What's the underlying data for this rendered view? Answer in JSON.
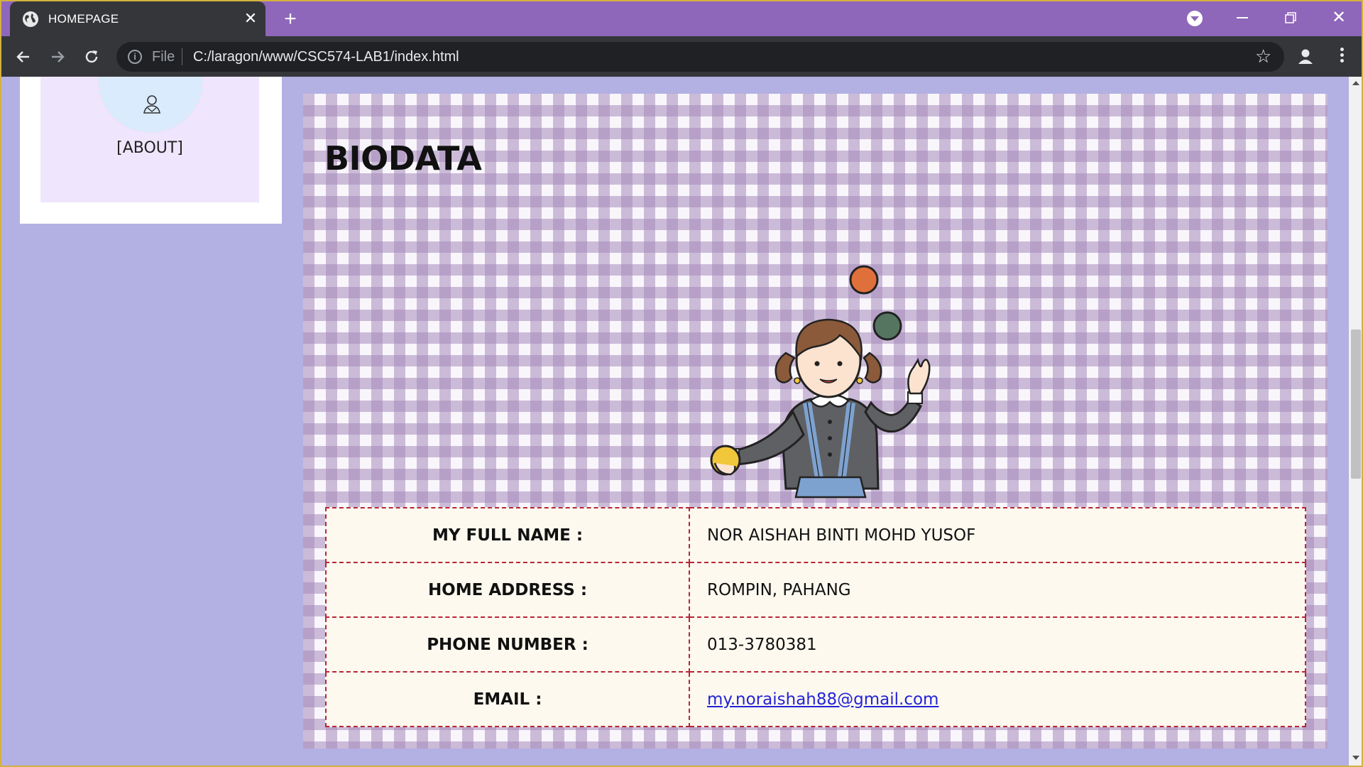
{
  "browser": {
    "tab_title": "HOMEPAGE",
    "tab_close_glyph": "✕",
    "new_tab_glyph": "+",
    "file_label": "File",
    "url": "C:/laragon/www/CSC574-LAB1/index.html",
    "icons": [
      "globe-icon",
      "back-icon",
      "forward-icon",
      "reload-icon",
      "info-icon",
      "star-icon",
      "account-icon",
      "menu-icon",
      "minimize-icon",
      "restore-icon",
      "close-icon"
    ],
    "tabbar_color": "#8e66ba",
    "toolbar_color": "#35363a"
  },
  "sidebar": {
    "about_label": "[ABOUT]"
  },
  "main": {
    "title": "BIODATA",
    "rows": [
      {
        "label": "MY FULL NAME :",
        "value": "NOR AISHAH BINTI MOHD YUSOF"
      },
      {
        "label": "HOME ADDRESS :",
        "value": "ROMPIN, PAHANG"
      },
      {
        "label": "PHONE NUMBER :",
        "value": "013-3780381"
      },
      {
        "label": "EMAIL :",
        "value": "my.noraishah88@gmail.com"
      }
    ]
  },
  "colors": {
    "page_bg": "#b3b0e3",
    "table_border": "#b62638",
    "table_bg": "#fdf9ef",
    "link": "#2323d6",
    "gingham": "#a68abc"
  }
}
